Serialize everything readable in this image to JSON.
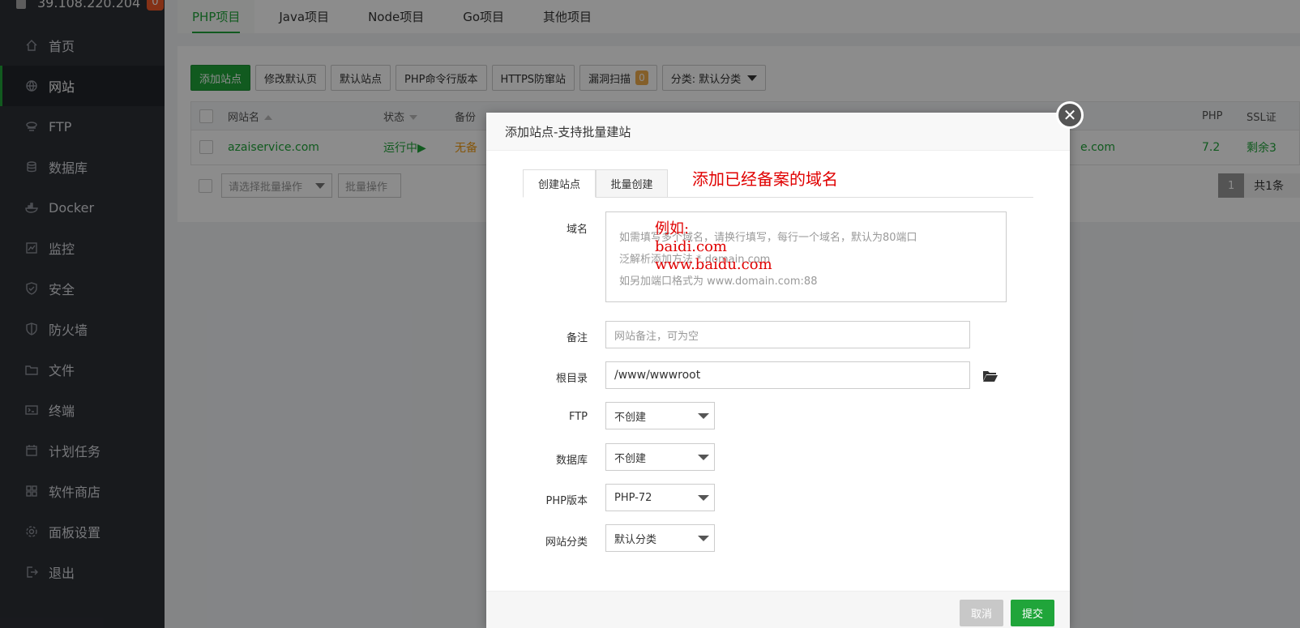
{
  "sidebar": {
    "server_ip": "39.108.220.204",
    "badge": "0",
    "items": [
      {
        "label": "首页",
        "icon": "home-icon"
      },
      {
        "label": "网站",
        "icon": "globe-icon",
        "active": true
      },
      {
        "label": "FTP",
        "icon": "ftp-icon"
      },
      {
        "label": "数据库",
        "icon": "database-icon"
      },
      {
        "label": "Docker",
        "icon": "docker-icon"
      },
      {
        "label": "监控",
        "icon": "monitor-icon"
      },
      {
        "label": "安全",
        "icon": "shield-icon"
      },
      {
        "label": "防火墙",
        "icon": "firewall-icon"
      },
      {
        "label": "文件",
        "icon": "folder-icon"
      },
      {
        "label": "终端",
        "icon": "terminal-icon"
      },
      {
        "label": "计划任务",
        "icon": "calendar-icon"
      },
      {
        "label": "软件商店",
        "icon": "apps-icon"
      },
      {
        "label": "面板设置",
        "icon": "gear-icon"
      },
      {
        "label": "退出",
        "icon": "logout-icon"
      }
    ]
  },
  "project_tabs": [
    "PHP项目",
    "Java项目",
    "Node项目",
    "Go项目",
    "其他项目"
  ],
  "toolbar": {
    "add_site": "添加站点",
    "modify_default": "修改默认页",
    "default_site": "默认站点",
    "php_cli": "PHP命令行版本",
    "https_guard": "HTTPS防窜站",
    "vuln_scan": "漏洞扫描",
    "vuln_count": "0",
    "category": "分类: 默认分类"
  },
  "table": {
    "headers": {
      "name": "网站名",
      "status": "状态",
      "backup": "备份",
      "php": "PHP",
      "ssl": "SSL证"
    },
    "row": {
      "name": "azaiservice.com",
      "status": "运行中▶",
      "backup": "无备",
      "domain_tail": "e.com",
      "php": "7.2",
      "ssl": "剩余3"
    }
  },
  "batch": {
    "select_placeholder": "请选择批量操作",
    "button": "批量操作"
  },
  "pager": {
    "page": "1",
    "total": "共1条"
  },
  "modal": {
    "title": "添加站点-支持批量建站",
    "tabs": [
      "创建站点",
      "批量创建"
    ],
    "annotation_title": "添加已经备案的域名",
    "annotation_example": [
      "例如:",
      "baidi.com",
      "www.baidu.com"
    ],
    "labels": {
      "domain": "域名",
      "remark": "备注",
      "root": "根目录",
      "ftp": "FTP",
      "database": "数据库",
      "php_version": "PHP版本",
      "category": "网站分类"
    },
    "domain_placeholder": [
      "如需填写多个域名，请换行填写，每行一个域名，默认为80端口",
      "泛解析添加方法 *.domain.com",
      "如另加端口格式为 www.domain.com:88"
    ],
    "remark_placeholder": "网站备注，可为空",
    "root_value": "/www/wwwroot",
    "ftp_value": "不创建",
    "database_value": "不创建",
    "php_value": "PHP-72",
    "category_value": "默认分类",
    "cancel": "取消",
    "submit": "提交"
  },
  "colors": {
    "accent": "#20a53a",
    "annotation": "#e00000",
    "sidebar_bg": "#2d3036"
  }
}
